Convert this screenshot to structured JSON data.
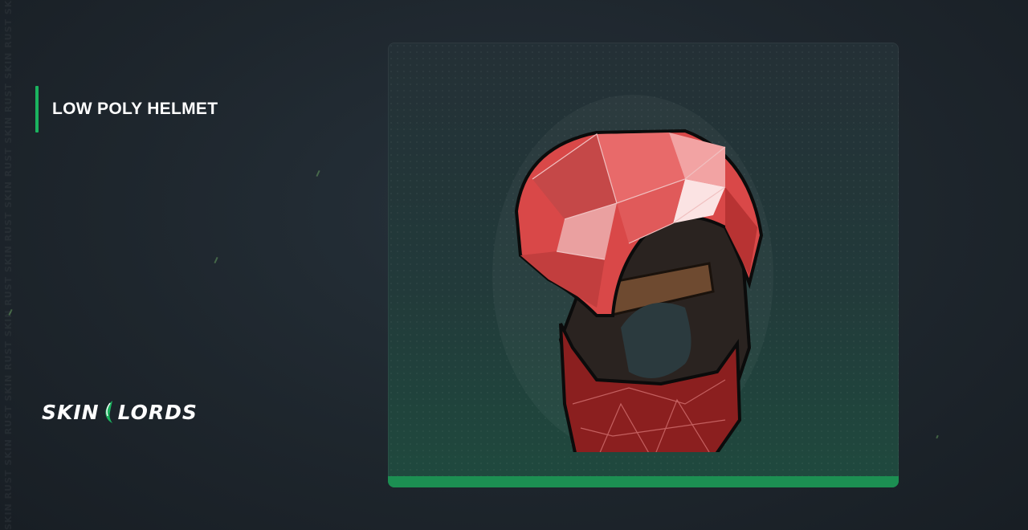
{
  "watermark_text": "SKIN RUST SKIN RUST SKIN RUST SKIN RUST SKIN RUST SKIN RUST SKIN RUST SKIN RUST SKIN RUST SKIN RUST",
  "item": {
    "title": "LOW POLY HELMET",
    "accent_color": "#1bb35f",
    "rarity_color": "#1c8f52",
    "image_icon": "red-low-poly-helmet-icon"
  },
  "logo": {
    "left_text": "SKIN",
    "right_text": "LORDS",
    "mark_icon": "green-blade-icon",
    "mark_color": "#1bb35f"
  }
}
